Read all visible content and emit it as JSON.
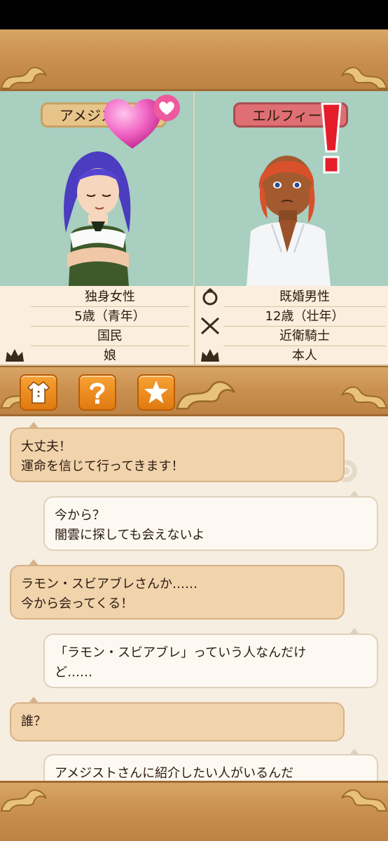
{
  "characters": {
    "left": {
      "name": "アメジスト",
      "info": [
        "独身女性",
        "5歳（青年）",
        "国民",
        "娘"
      ],
      "plate_color": "#e7c48a"
    },
    "right": {
      "name": "エルフィー",
      "info": [
        "既婚男性",
        "12歳（壮年）",
        "近衛騎士",
        "本人"
      ],
      "plate_color": "#df6f72"
    }
  },
  "icons": {
    "heart": "heart-icon",
    "exclaim": "exclamation-icon",
    "ring": "ring-icon",
    "swords": "crossed-swords-icon",
    "crown": "crown-icon"
  },
  "toolbar": {
    "buttons": [
      "clothing-icon",
      "question-icon",
      "star-icon"
    ]
  },
  "chat": [
    {
      "side": "left",
      "lines": [
        "大丈夫！",
        "運命を信じて行ってきます！"
      ]
    },
    {
      "side": "right",
      "lines": [
        "今から？",
        "闇雲に探しても会えないよ"
      ]
    },
    {
      "side": "left",
      "lines": [
        "ラモン・スビアブレさんか……",
        "今から会ってくる！"
      ]
    },
    {
      "side": "right",
      "lines": [
        "「ラモン・スビアブレ」っていう人なんだけ",
        "ど……"
      ]
    },
    {
      "side": "left",
      "lines": [
        "誰？"
      ]
    },
    {
      "side": "right",
      "lines": [
        "アメジストさんに紹介したい人がいるんだ"
      ]
    }
  ],
  "colors": {
    "wood": "#c98f4e",
    "button": "#f08a1a",
    "bubble_left": "#f1d3ac",
    "bubble_right": "#fdf9f2",
    "portrait_bg": "#a8cfbf"
  }
}
